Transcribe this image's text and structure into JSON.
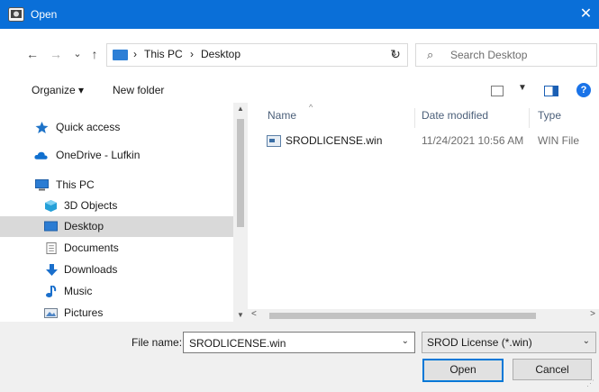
{
  "window": {
    "title": "Open",
    "close_glyph": "✕"
  },
  "nav_buttons": {
    "back": "←",
    "forward": "→",
    "recent": "⌄",
    "up": "↑"
  },
  "address": {
    "breadcrumbs": [
      "This PC",
      "Desktop"
    ],
    "separator": "›"
  },
  "search": {
    "placeholder": "Search Desktop"
  },
  "toolbar": {
    "organize_label": "Organize ▾",
    "new_folder_label": "New folder",
    "help": "?"
  },
  "sidebar": {
    "items": [
      {
        "label": "Quick access",
        "icon": "star-icon"
      },
      {
        "label": "OneDrive - Lufkin",
        "icon": "cloud-icon"
      },
      {
        "label": "This PC",
        "icon": "computer-icon"
      },
      {
        "label": "3D Objects",
        "icon": "cube-icon"
      },
      {
        "label": "Desktop",
        "icon": "desktop-icon",
        "selected": true
      },
      {
        "label": "Documents",
        "icon": "document-icon"
      },
      {
        "label": "Downloads",
        "icon": "download-icon"
      },
      {
        "label": "Music",
        "icon": "music-icon"
      },
      {
        "label": "Pictures",
        "icon": "pictures-icon"
      }
    ]
  },
  "file_list": {
    "columns": [
      "Name",
      "Date modified",
      "Type"
    ],
    "rows": [
      {
        "name": "SRODLICENSE.win",
        "date_modified": "11/24/2021 10:56 AM",
        "type": "WIN File"
      }
    ]
  },
  "footer": {
    "file_name_label": "File name:",
    "file_name_value": "SRODLICENSE.win",
    "file_type_value": "SROD License (*.win)",
    "open_label": "Open",
    "cancel_label": "Cancel"
  },
  "colors": {
    "title_bar": "#0a6fd8",
    "selection": "#cce8ff",
    "accent": "#0078d7"
  }
}
